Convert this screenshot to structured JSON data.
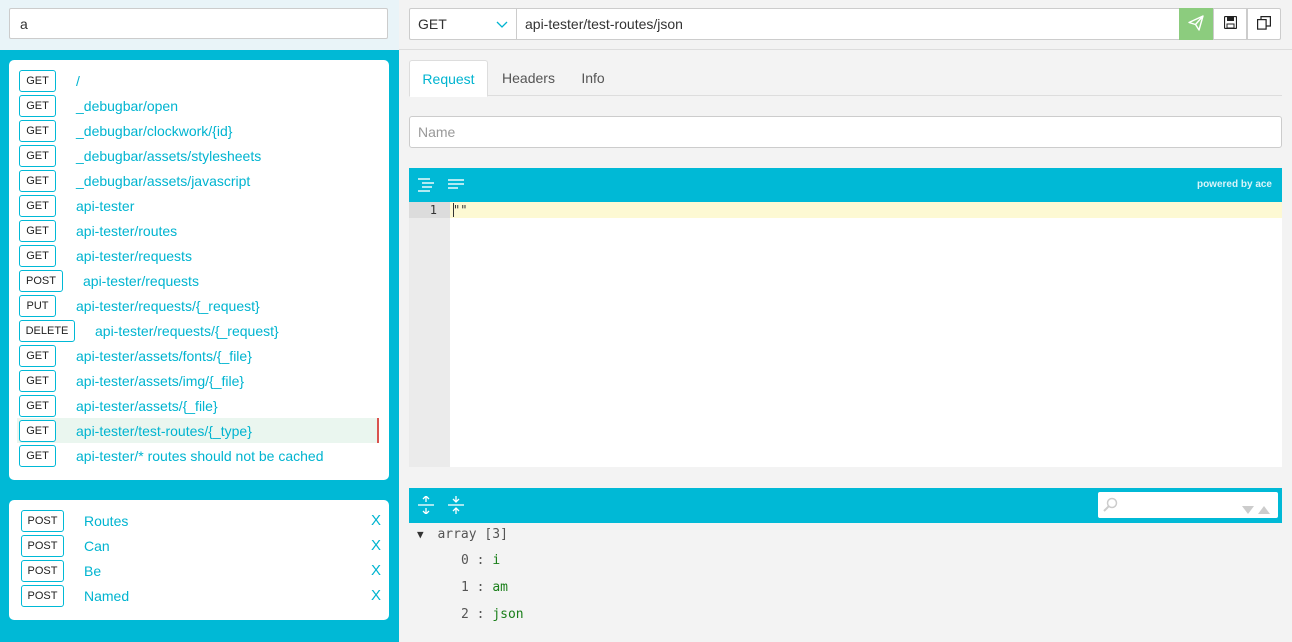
{
  "filter": {
    "value": "a"
  },
  "routes": [
    {
      "method": "GET",
      "path": "/"
    },
    {
      "method": "GET",
      "path": "_debugbar/open"
    },
    {
      "method": "GET",
      "path": "_debugbar/clockwork/{id}"
    },
    {
      "method": "GET",
      "path": "_debugbar/assets/stylesheets"
    },
    {
      "method": "GET",
      "path": "_debugbar/assets/javascript"
    },
    {
      "method": "GET",
      "path": "api-tester"
    },
    {
      "method": "GET",
      "path": "api-tester/routes"
    },
    {
      "method": "GET",
      "path": "api-tester/requests"
    },
    {
      "method": "POST",
      "path": "api-tester/requests"
    },
    {
      "method": "PUT",
      "path": "api-tester/requests/{_request}"
    },
    {
      "method": "DELETE",
      "path": "api-tester/requests/{_request}"
    },
    {
      "method": "GET",
      "path": "api-tester/assets/fonts/{_file}"
    },
    {
      "method": "GET",
      "path": "api-tester/assets/img/{_file}"
    },
    {
      "method": "GET",
      "path": "api-tester/assets/{_file}"
    },
    {
      "method": "GET",
      "path": "api-tester/test-routes/{_type}",
      "active": true
    },
    {
      "method": "GET",
      "path": "api-tester/* routes should not be cached"
    }
  ],
  "saved_requests": [
    {
      "method": "POST",
      "name": "Routes",
      "remove": "X"
    },
    {
      "method": "POST",
      "name": "Can",
      "remove": "X"
    },
    {
      "method": "POST",
      "name": "Be",
      "remove": "X"
    },
    {
      "method": "POST",
      "name": "Named",
      "remove": "X"
    }
  ],
  "request_bar": {
    "method": "GET",
    "url": "api-tester/test-routes/json"
  },
  "tabs": [
    {
      "label": "Request",
      "active": true
    },
    {
      "label": "Headers",
      "active": false
    },
    {
      "label": "Info",
      "active": false
    }
  ],
  "name_field": {
    "placeholder": "Name",
    "value": ""
  },
  "editor": {
    "line_number": "1",
    "content": "\"\"",
    "powered_by": "powered by ace"
  },
  "response": {
    "root_label": "array",
    "root_count": "[3]",
    "items": [
      {
        "key": "0",
        "value": "i"
      },
      {
        "key": "1",
        "value": "am"
      },
      {
        "key": "2",
        "value": "json"
      }
    ]
  },
  "colors": {
    "accent": "#00b9d6",
    "send_button": "#8ccc7e",
    "active_marker": "#d9534f"
  }
}
